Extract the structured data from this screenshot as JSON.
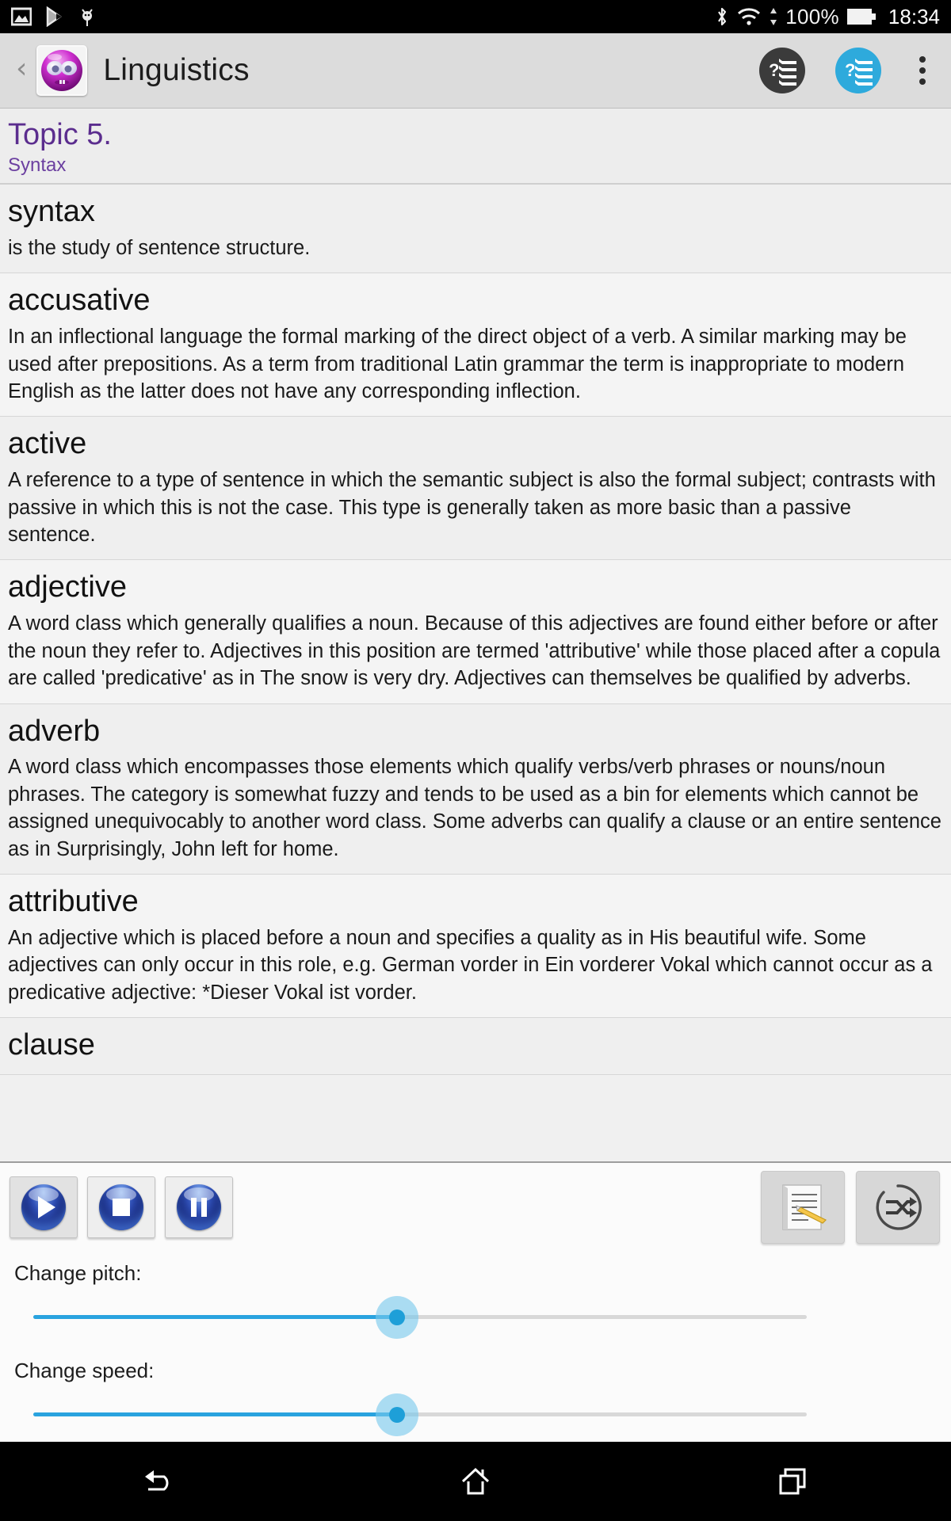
{
  "status_bar": {
    "icons_left": [
      "screenshot-icon",
      "play-store-icon",
      "android-debug-icon"
    ],
    "icons_right": [
      "bluetooth-icon",
      "wifi-icon",
      "data-transfer-icon",
      "battery-icon"
    ],
    "battery_percent": "100%",
    "clock": "18:34"
  },
  "action_bar": {
    "back_label": "‹",
    "app_icon": "purple-face-app-icon",
    "title": "Linguistics",
    "quiz_dark_label": "quiz-multiple-choice-dark-icon",
    "quiz_blue_label": "quiz-multiple-choice-blue-icon",
    "overflow_label": "more-options-icon"
  },
  "topic": {
    "title": "Topic 5.",
    "subtitle": "Syntax"
  },
  "entries": [
    {
      "term": "syntax",
      "definition": "is the study of sentence structure."
    },
    {
      "term": "accusative",
      "definition": "In an inflectional language the formal marking of the direct object of a verb. A similar marking may be used after prepositions. As a term from traditional Latin grammar the term is inappropriate to modern English as the latter does not have any corresponding inflection."
    },
    {
      "term": "active",
      "definition": "A reference to a type of sentence in which the semantic subject is also the formal subject; contrasts with passive in which this is not the case. This type is generally taken as more basic than a passive sentence."
    },
    {
      "term": "adjective",
      "definition": "A word class which generally qualifies a noun. Because of this adjectives are found either before  or after the noun they refer to. Adjectives in this position are termed 'attributive' while those placed after a copula are called 'predicative' as in The snow is very dry. Adjectives can themselves be qualified by adverbs."
    },
    {
      "term": "adverb",
      "definition": "A word class which encompasses those elements which qualify verbs/verb phrases or nouns/noun phrases. The category is somewhat fuzzy and tends to be used as a bin for elements which cannot be assigned unequivocably to another word class. Some adverbs can qualify a clause or an entire sentence as in Surprisingly, John left for home."
    },
    {
      "term": "attributive",
      "definition": "An adjective which is placed before a noun and specifies a quality as in His beautiful wife. Some adjectives can only occur in this role, e.g. German vorder in Ein vorderer Vokal which cannot occur as a predicative adjective: *Dieser Vokal ist vorder."
    },
    {
      "term": "clause",
      "definition": ""
    }
  ],
  "controls": {
    "play_label": "play-icon",
    "stop_label": "stop-icon",
    "pause_label": "pause-icon",
    "notes_label": "notes-edit-icon",
    "shuffle_label": "shuffle-icon",
    "pitch_label": "Change pitch:",
    "speed_label": "Change speed:",
    "pitch_value_percent": 47,
    "speed_value_percent": 47,
    "accent_color": "#29a3df"
  },
  "navigation_bar": {
    "back_label": "back-icon",
    "home_label": "home-icon",
    "recents_label": "recents-icon"
  }
}
